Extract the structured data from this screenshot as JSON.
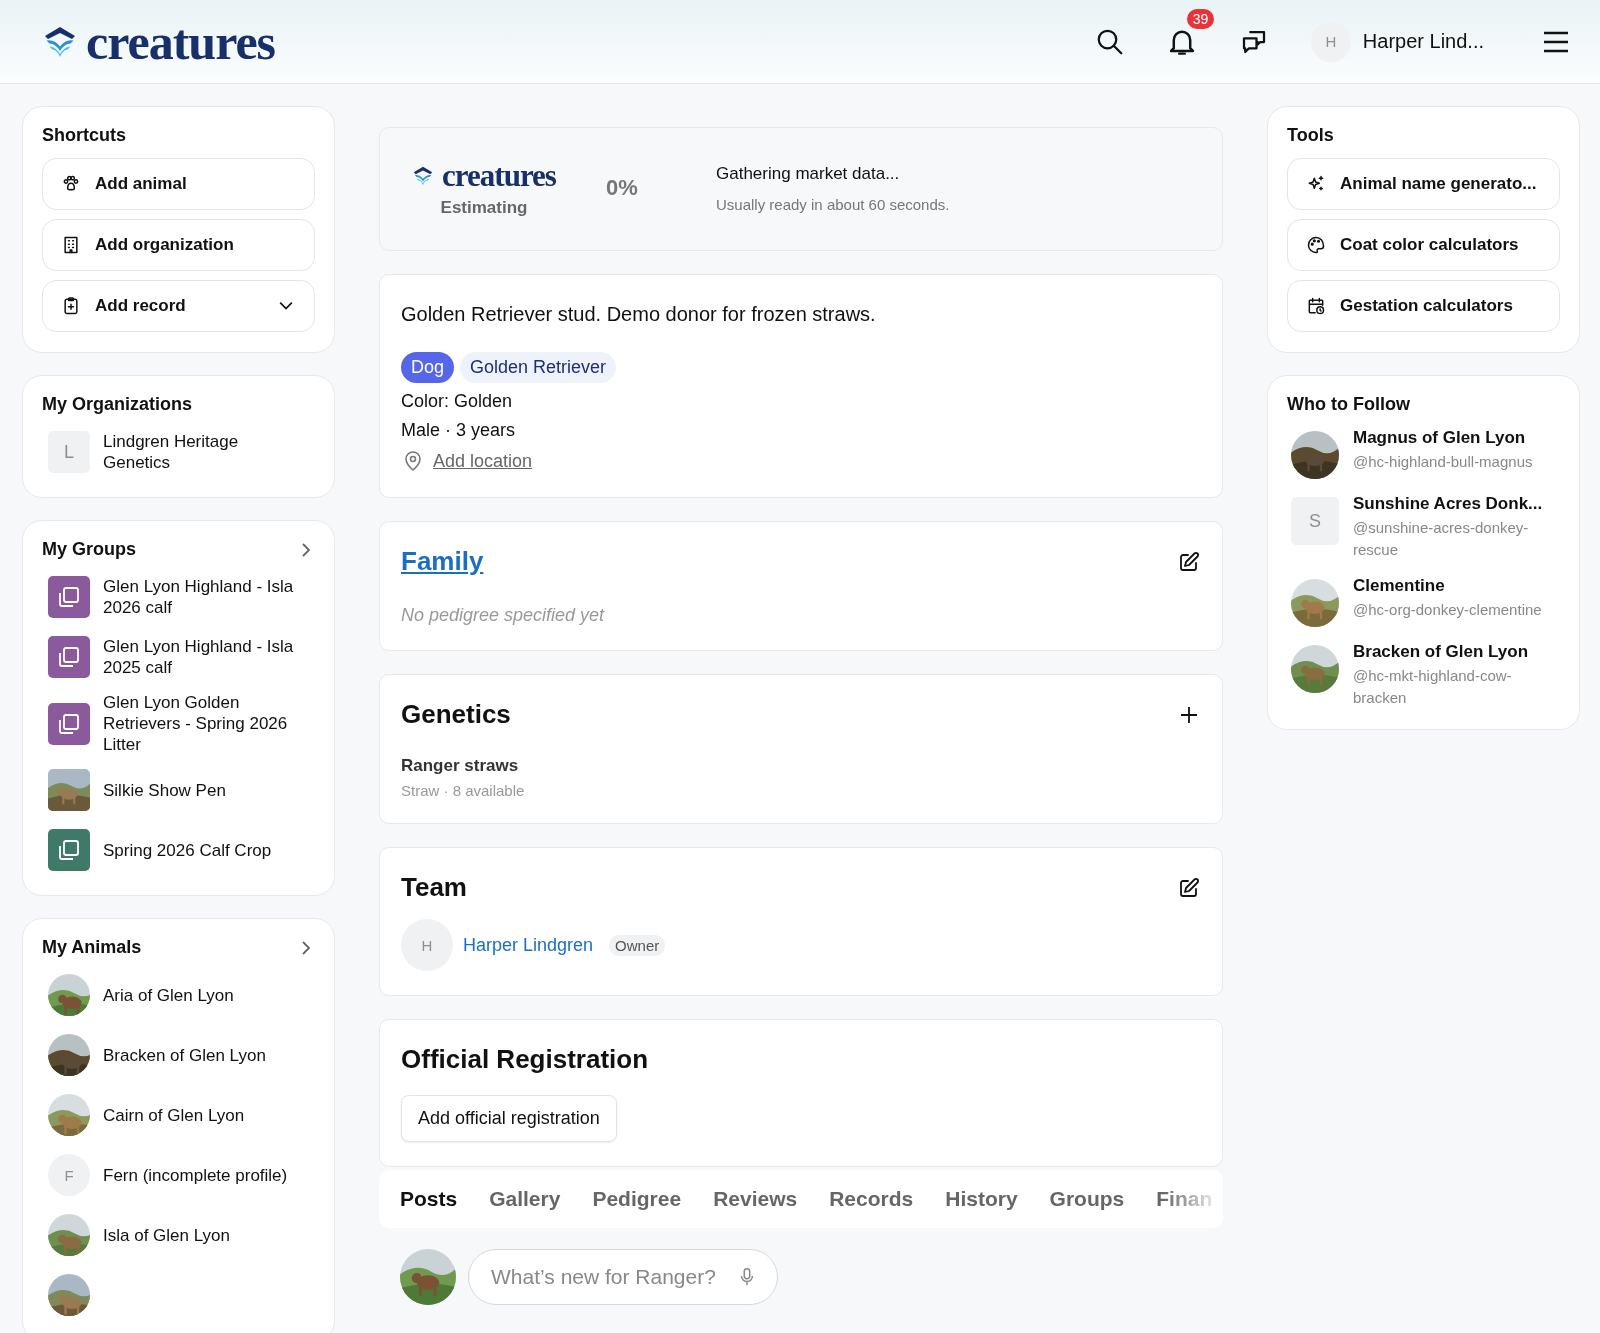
{
  "header": {
    "logo": "creatures",
    "notifications": "39",
    "user": {
      "initial": "H",
      "name": "Harper Lind..."
    }
  },
  "shortcuts": {
    "title": "Shortcuts",
    "items": [
      {
        "label": "Add animal",
        "kind": "paw"
      },
      {
        "label": "Add organization",
        "kind": "building"
      },
      {
        "label": "Add record",
        "kind": "clipboard",
        "dropdown": true
      }
    ]
  },
  "organizations": {
    "title": "My Organizations",
    "items": [
      {
        "initial": "L",
        "name": "Lindgren Heritage Genetics"
      }
    ]
  },
  "groups": {
    "title": "My Groups",
    "items": [
      {
        "name": "Glen Lyon Highland - Isla 2026 calf",
        "kind": "stack",
        "color": "#8b5a9c"
      },
      {
        "name": "Glen Lyon Highland - Isla 2025 calf",
        "kind": "stack",
        "color": "#8b5a9c"
      },
      {
        "name": "Glen Lyon Golden Retrievers - Spring 2026 Litter",
        "kind": "stack",
        "color": "#8b5a9c"
      },
      {
        "name": "Silkie Show Pen",
        "kind": "picture"
      },
      {
        "name": "Spring 2026 Calf Crop",
        "kind": "stack",
        "color": "#3f7a68"
      }
    ]
  },
  "animals": {
    "title": "My Animals",
    "items": [
      {
        "name": "Aria of Glen Lyon",
        "kind": "picture"
      },
      {
        "name": "Bracken of Glen Lyon",
        "kind": "picture"
      },
      {
        "name": "Cairn of Glen Lyon",
        "kind": "picture"
      },
      {
        "name": "Fern (incomplete profile)",
        "kind": "initial",
        "initial": "F"
      },
      {
        "name": "Isla of Glen Lyon",
        "kind": "picture"
      },
      {
        "kind": "picture"
      }
    ]
  },
  "estimate": {
    "logo": "creatures",
    "status": "Estimating",
    "percent": "0%",
    "message": "Gathering market data...",
    "note": "Usually ready in about 60 seconds."
  },
  "profile": {
    "description": "Golden Retriever stud. Demo donor for frozen straws.",
    "tags": [
      {
        "label": "Dog",
        "selected": true
      },
      {
        "label": "Golden Retriever",
        "selected": false
      }
    ],
    "color_text": "Color: Golden",
    "sex_age": "Male · 3 years",
    "location_link": "Add location"
  },
  "family": {
    "title": "Family",
    "empty": "No pedigree specified yet"
  },
  "genetics": {
    "title": "Genetics",
    "items": [
      {
        "name": "Ranger straws",
        "detail": "Straw · 8 available"
      }
    ]
  },
  "team": {
    "title": "Team",
    "members": [
      {
        "initial": "H",
        "name": "Harper Lindgren",
        "role": "Owner"
      }
    ]
  },
  "registration": {
    "title": "Official Registration",
    "button": "Add official registration"
  },
  "tabs": [
    {
      "label": "Posts",
      "selected": true
    },
    {
      "label": "Gallery",
      "selected": false
    },
    {
      "label": "Pedigree",
      "selected": false
    },
    {
      "label": "Reviews",
      "selected": false
    },
    {
      "label": "Records",
      "selected": false
    },
    {
      "label": "History",
      "selected": false
    },
    {
      "label": "Groups",
      "selected": false
    },
    {
      "label": "Finan",
      "selected": false
    }
  ],
  "composer": {
    "placeholder": "What’s new for Ranger?"
  },
  "tools": {
    "title": "Tools",
    "items": [
      {
        "label": "Animal name generato...",
        "kind": "sparkle"
      },
      {
        "label": "Coat color calculators",
        "kind": "palette"
      },
      {
        "label": "Gestation calculators",
        "kind": "calendar"
      }
    ]
  },
  "follow": {
    "title": "Who to Follow",
    "items": [
      {
        "name": "Magnus of Glen Lyon",
        "handle": "@hc-highland-bull-magnus",
        "kind": "picture"
      },
      {
        "name": "Sunshine Acres Donk...",
        "handle": "@sunshine-acres-donkey-rescue",
        "kind": "initial",
        "initial": "S"
      },
      {
        "name": "Clementine",
        "handle": "@hc-org-donkey-clementine",
        "kind": "picture"
      },
      {
        "name": "Bracken of Glen Lyon",
        "handle": "@hc-mkt-highland-cow-bracken",
        "kind": "picture"
      }
    ]
  }
}
